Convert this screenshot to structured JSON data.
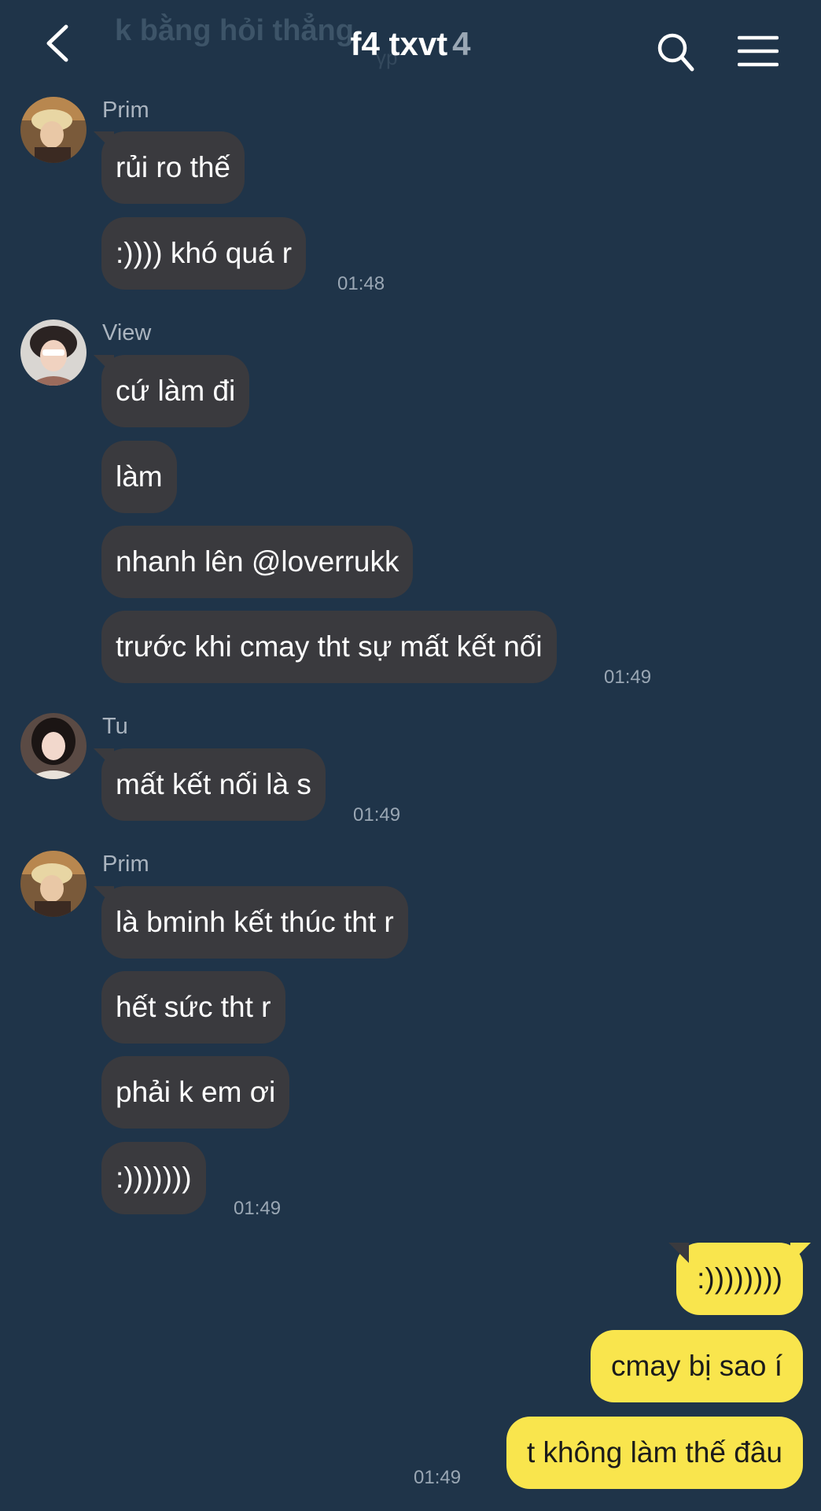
{
  "header": {
    "ghost_text": "k bằng hỏi thẳng",
    "title": "f4 txvt",
    "member_count": "4"
  },
  "groups": [
    {
      "sender": "Prim",
      "messages": [
        "rủi ro thế",
        ":)))) khó quá r"
      ],
      "time": "01:48"
    },
    {
      "sender": "View",
      "messages": [
        "cứ làm đi",
        "làm",
        "nhanh lên @loverrukk",
        "trước khi cmay tht sự mất kết nối"
      ],
      "time": "01:49"
    },
    {
      "sender": "Tu",
      "messages": [
        "mất kết nối là s"
      ],
      "time": "01:49"
    },
    {
      "sender": "Prim",
      "messages": [
        "là bminh kết thúc tht r",
        "hết sức tht r",
        "phải k em ơi",
        ":)))))))"
      ],
      "time": "01:49"
    }
  ],
  "mine": {
    "messages": [
      ":))))))))",
      "cmay bị sao í",
      "t không làm thế đâu"
    ],
    "time": "01:49"
  },
  "colors": {
    "background": "#1f3449",
    "bubble_other": "#3a3a3e",
    "bubble_mine": "#f9e54d"
  }
}
